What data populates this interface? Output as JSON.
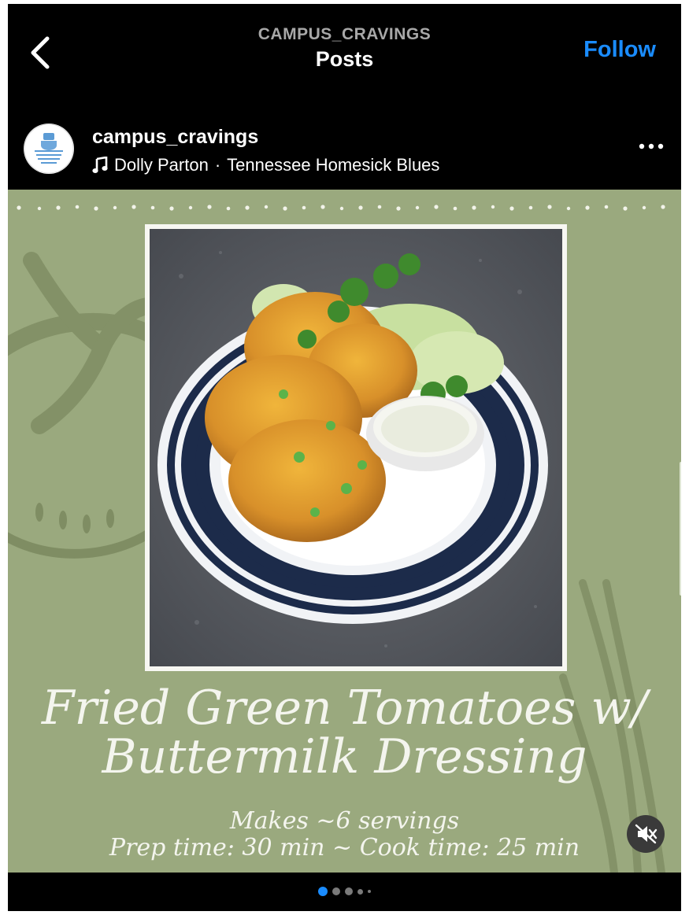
{
  "header": {
    "account": "CAMPUS_CRAVINGS",
    "title": "Posts",
    "follow_label": "Follow"
  },
  "post": {
    "username": "campus_cravings",
    "music_artist": "Dolly Parton",
    "music_separator": "·",
    "music_track": "Tennessee Homesick Blues",
    "avatar_text": "Campus Cravings Recipes for the Homesick Student"
  },
  "media": {
    "title_line1": "Fried Green Tomatoes w/",
    "title_line2": "Buttermilk Dressing",
    "servings": "Makes ~6 servings",
    "times": "Prep time: 30 min ~ Cook time: 25 min",
    "background_color": "#9aa97e"
  },
  "carousel": {
    "count": 5,
    "active_index": 0,
    "active_color": "#1a8cff"
  },
  "icons": {
    "back": "chevron-left-icon",
    "more": "more-horizontal-icon",
    "music": "music-note-icon",
    "mute": "speaker-muted-icon"
  }
}
